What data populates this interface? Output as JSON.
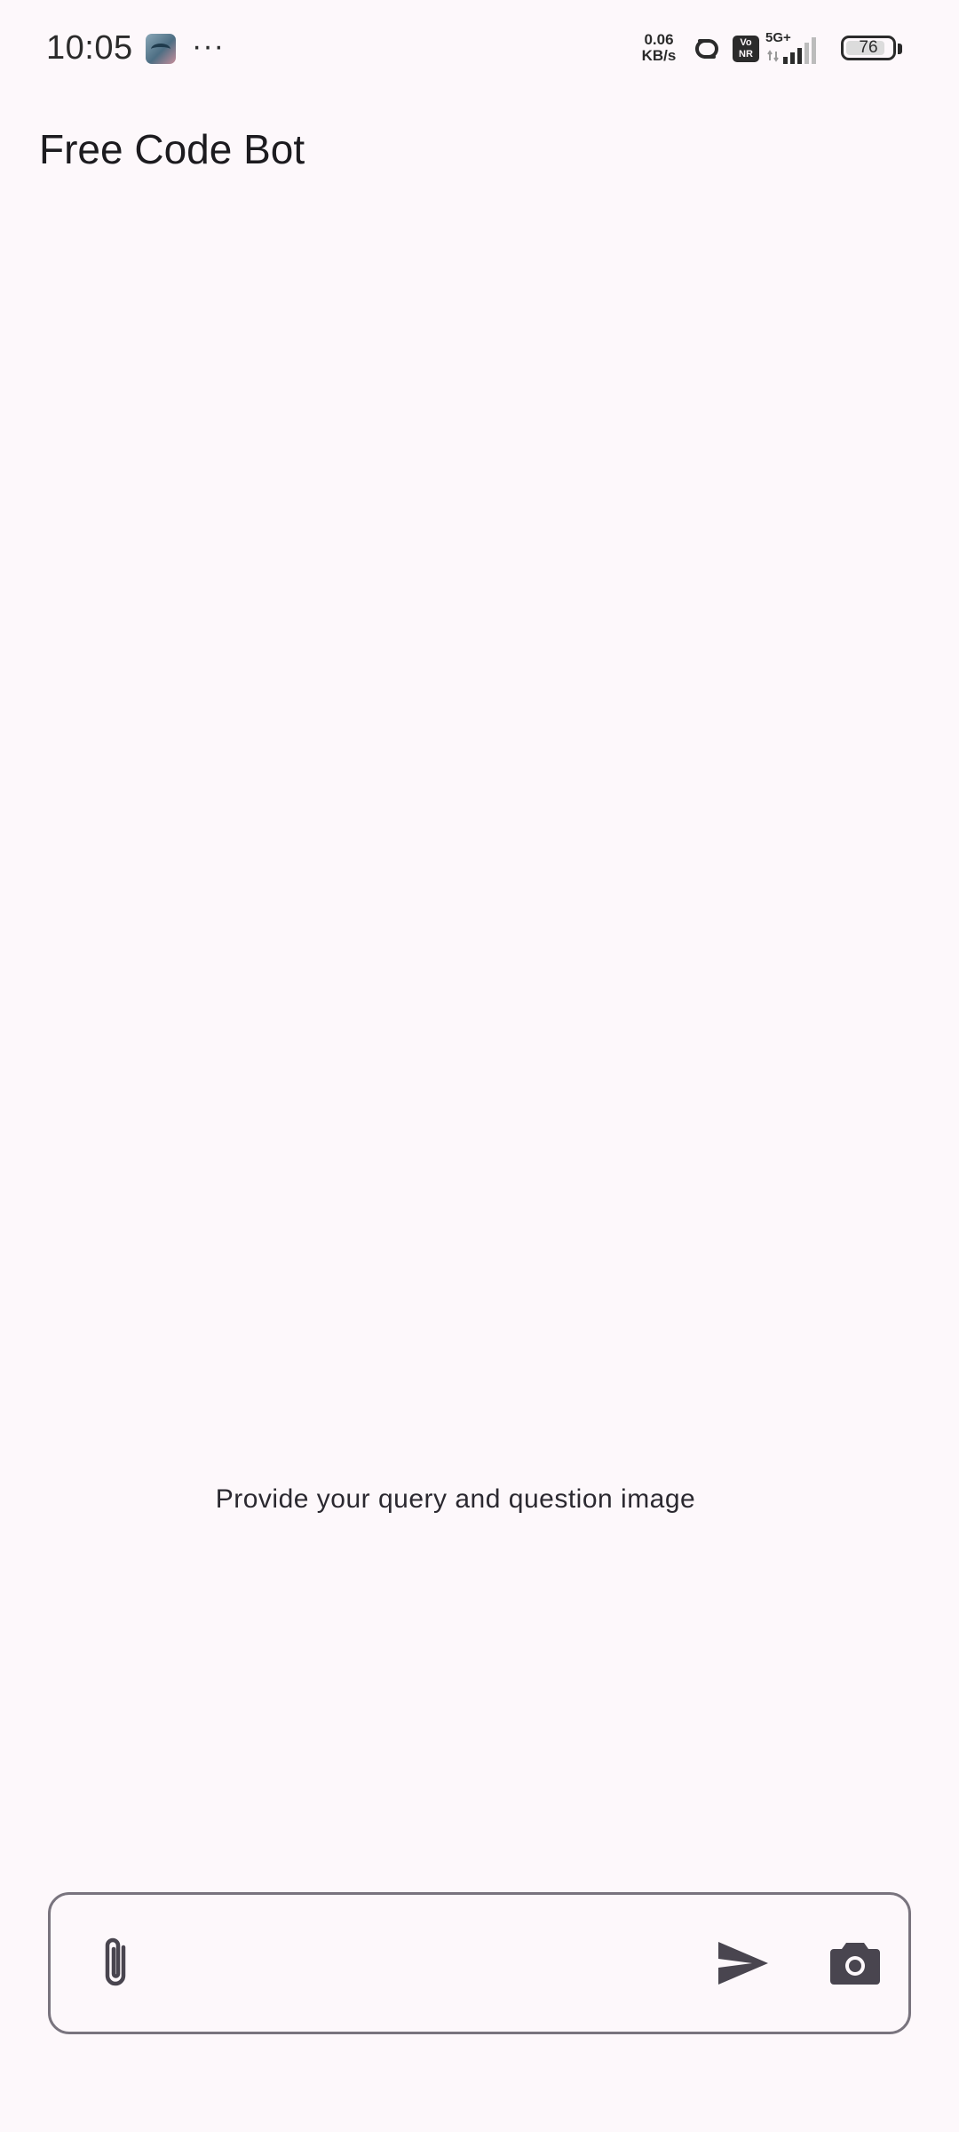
{
  "status_bar": {
    "time": "10:05",
    "more_indicator": "···",
    "net_speed_value": "0.06",
    "net_speed_unit": "KB/s",
    "vonr_top": "Vo",
    "vonr_bottom": "NR",
    "network_type": "5G+",
    "battery_level": "76",
    "icons": [
      "app-notification-icon",
      "hotspot-icon",
      "vonr-icon",
      "signal-icon",
      "battery-icon"
    ]
  },
  "app_bar": {
    "title": "Free Code Bot"
  },
  "chat": {
    "empty_hint": "Provide your query and question image"
  },
  "composer": {
    "input_value": "",
    "input_placeholder": "",
    "icons": [
      "attach-icon",
      "send-icon",
      "camera-icon"
    ]
  },
  "colors": {
    "background": "#fdf8fb",
    "outline": "#79747e",
    "icon": "#49454f",
    "text": "#1c1b1f"
  }
}
